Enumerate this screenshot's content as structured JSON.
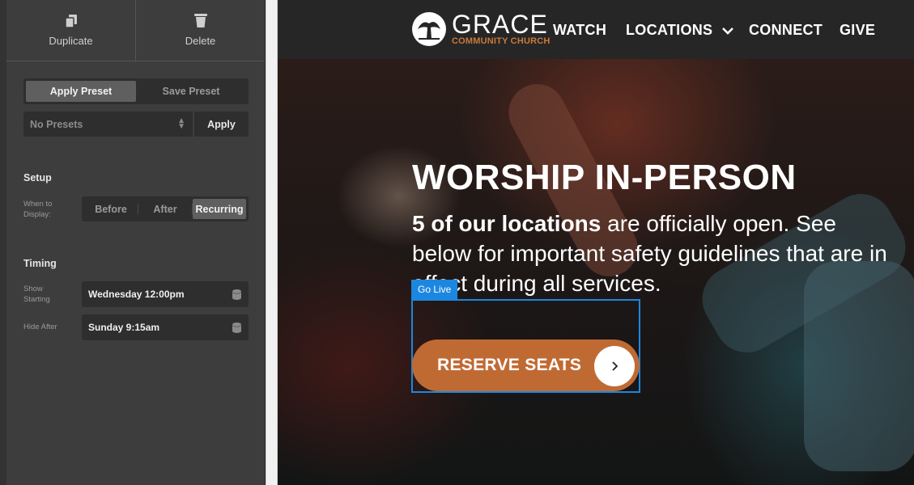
{
  "editor": {
    "top_actions": [
      {
        "label": "Duplicate",
        "icon": "duplicate-icon"
      },
      {
        "label": "Delete",
        "icon": "trash-icon"
      }
    ],
    "preset_tabs": [
      {
        "label": "Apply Preset",
        "active": true
      },
      {
        "label": "Save Preset",
        "active": false
      }
    ],
    "preset_select_value": "No Presets",
    "apply_label": "Apply",
    "setup": {
      "title": "Setup",
      "when_label": "When to Display:",
      "options": [
        {
          "label": "Before",
          "active": false
        },
        {
          "label": "After",
          "active": false
        },
        {
          "label": "Recurring",
          "active": true
        }
      ]
    },
    "timing": {
      "title": "Timing",
      "show_label": "Show Starting",
      "show_value": "Wednesday 12:00pm",
      "hide_label": "Hide After",
      "hide_value": "Sunday 9:15am"
    }
  },
  "site": {
    "logo_title": "GRACE",
    "logo_subtitle": "COMMUNITY CHURCH",
    "nav": [
      "WATCH",
      "LOCATIONS",
      "CONNECT",
      "GIVE"
    ],
    "hero_title": "WORSHIP IN-PERSON",
    "hero_body_bold": "5 of our locations",
    "hero_body_rest": "are officially open. See below for important safety guidelines that are in effect during all services.",
    "golive_tag": "Go Live",
    "cta_label": "RESERVE SEATS",
    "cta_icon": "chevron-right-icon",
    "colors": {
      "accent": "#c06a33",
      "selection": "#1c87e0",
      "logo_sub": "#c77a3c"
    }
  }
}
